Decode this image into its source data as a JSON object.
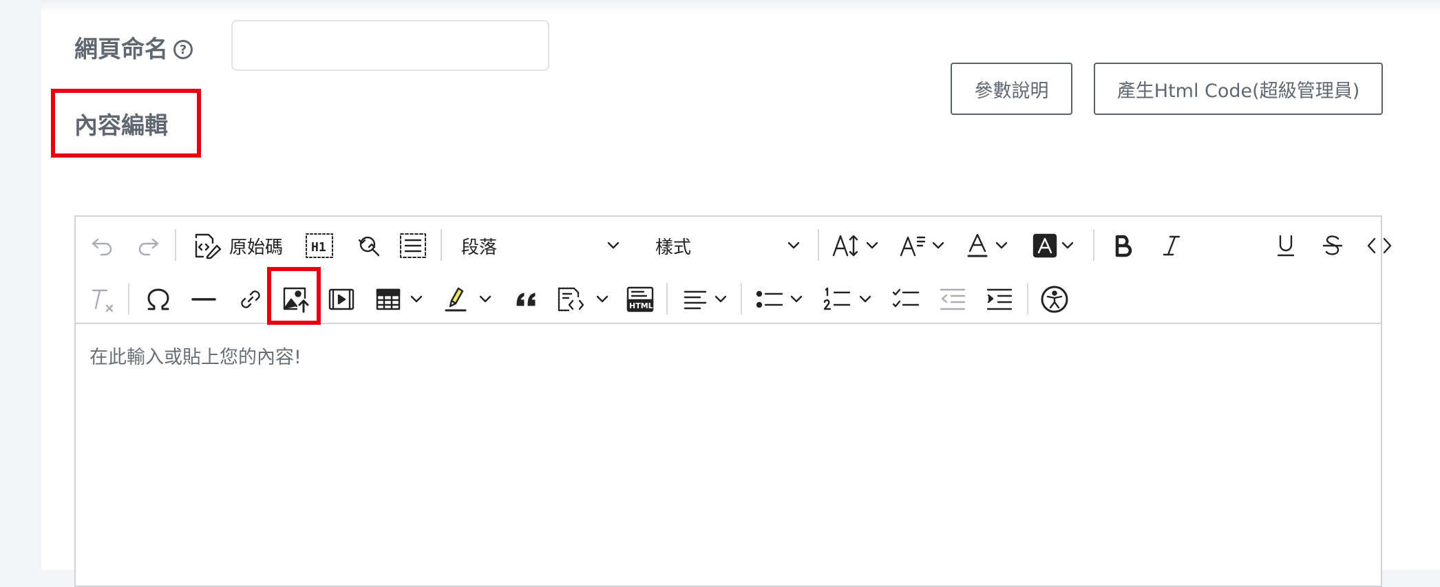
{
  "form": {
    "page_name_label": "網頁命名",
    "help_icon": "?",
    "page_name_value": "",
    "content_label": "內容編輯"
  },
  "buttons": {
    "params": "參數說明",
    "generate": "產生Html Code(超級管理員)"
  },
  "toolbar": {
    "source_label": "原始碼",
    "heading_select": "段落",
    "style_select": "樣式",
    "heading_badge": "H1",
    "html_badge": "HTML",
    "icons_row1": [
      "undo-icon",
      "redo-icon",
      "source-code-icon",
      "heading-icon",
      "find-replace-icon",
      "select-all-icon",
      "font-size-icon",
      "line-height-icon",
      "font-color-icon",
      "background-color-icon",
      "bold-icon",
      "italic-icon",
      "underline-icon",
      "strikethrough-icon",
      "code-icon"
    ],
    "icons_row2": [
      "remove-format-icon",
      "special-char-icon",
      "horizontal-line-icon",
      "link-icon",
      "image-upload-icon",
      "media-embed-icon",
      "table-icon",
      "highlight-icon",
      "blockquote-icon",
      "code-block-icon",
      "html-embed-icon",
      "align-icon",
      "bullet-list-icon",
      "numbered-list-icon",
      "todo-list-icon",
      "outdent-icon",
      "indent-icon",
      "accessibility-icon"
    ]
  },
  "editor": {
    "placeholder": "在此輸入或貼上您的內容!"
  },
  "colors": {
    "highlight_box": "#e60012",
    "label_text": "#5f6771",
    "highlighter": "#f0e860"
  }
}
